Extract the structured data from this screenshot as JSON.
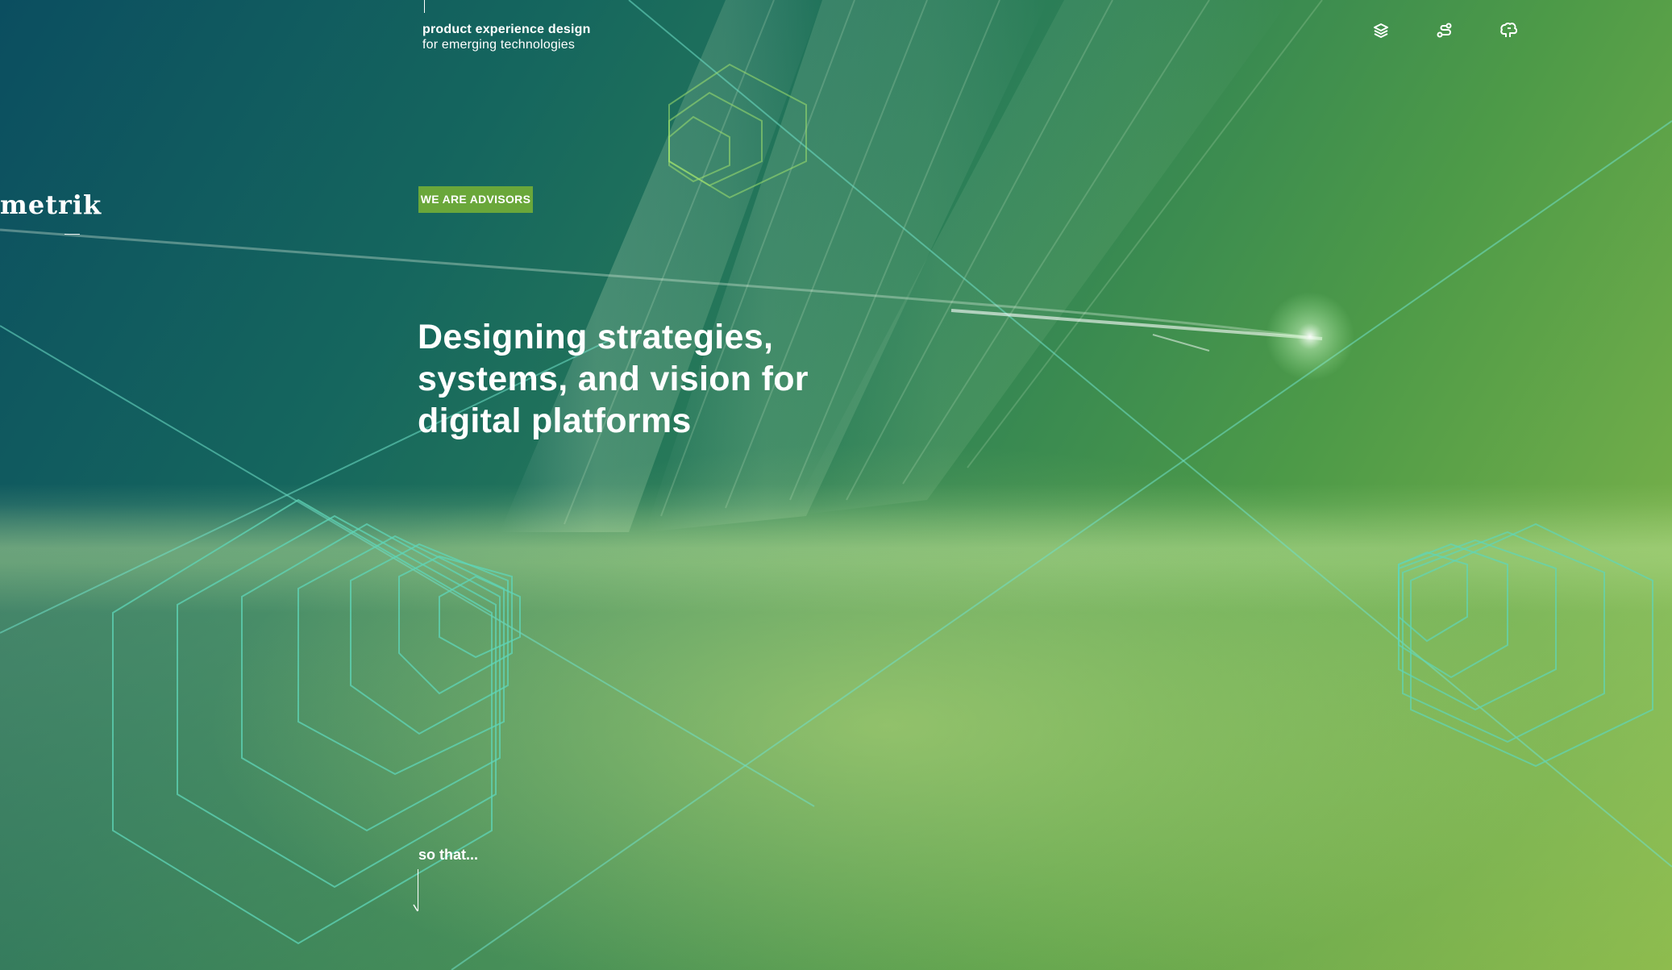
{
  "tagline": {
    "line1": "product experience design",
    "line2": "for emerging technologies"
  },
  "brand": {
    "logo": "metrik"
  },
  "hero": {
    "badge": "WE ARE ADVISORS",
    "headline": "Designing strategies, systems, and vision for digital platforms",
    "continuation": "so that..."
  },
  "nav": {
    "icons": [
      "stack-icon",
      "path-icon",
      "brain-icon"
    ]
  },
  "colors": {
    "badge": "#6aa73a",
    "teal_deep": "#0b4e60",
    "lime_light": "#b8d66a",
    "hex_stroke": "#5fd6b8"
  }
}
